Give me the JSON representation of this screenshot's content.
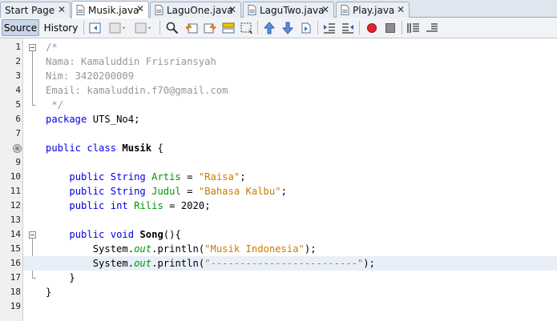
{
  "tabs": [
    {
      "label": "Start Page",
      "active": false,
      "icon": "none"
    },
    {
      "label": "Musik.java",
      "active": true,
      "icon": "java-file-icon"
    },
    {
      "label": "LaguOne.java",
      "active": false,
      "icon": "java-file-icon"
    },
    {
      "label": "LaguTwo.java",
      "active": false,
      "icon": "java-file-icon"
    },
    {
      "label": "Play.java",
      "active": false,
      "icon": "java-file-icon"
    }
  ],
  "tab_close_glyph": "✕",
  "toolbar": {
    "source_label": "Source",
    "history_label": "History"
  },
  "editor": {
    "highlighted_line": 16,
    "lines": [
      {
        "n": "1",
        "text": "/*"
      },
      {
        "n": "2",
        "text": "Nama: Kamaluddin Frisriansyah"
      },
      {
        "n": "3",
        "text": "Nim: 3420200009"
      },
      {
        "n": "4",
        "text": "Email: kamaluddin.f70@gmail.com"
      },
      {
        "n": "5",
        "text": " */"
      },
      {
        "n": "6",
        "text": "package UTS_No4;"
      },
      {
        "n": "7",
        "text": ""
      },
      {
        "n": "8",
        "text": "public class Musik {"
      },
      {
        "n": "9",
        "text": ""
      },
      {
        "n": "10",
        "text": "    public String Artis = \"Raisa\";"
      },
      {
        "n": "11",
        "text": "    public String Judul = \"Bahasa Kalbu\";"
      },
      {
        "n": "12",
        "text": "    public int Rilis = 2020;"
      },
      {
        "n": "13",
        "text": ""
      },
      {
        "n": "14",
        "text": "    public void Song(){"
      },
      {
        "n": "15",
        "text": "        System.out.println(\"Musik Indonesia\");"
      },
      {
        "n": "16",
        "text": "        System.out.println(\"-------------------------\");"
      },
      {
        "n": "17",
        "text": "    }"
      },
      {
        "n": "18",
        "text": "}"
      },
      {
        "n": "19",
        "text": ""
      }
    ]
  },
  "colors": {
    "keyword": "#0000e6",
    "string": "#ce7b00",
    "comment": "#969696",
    "field": "#009900",
    "highlight_line": "#e9eff8"
  }
}
